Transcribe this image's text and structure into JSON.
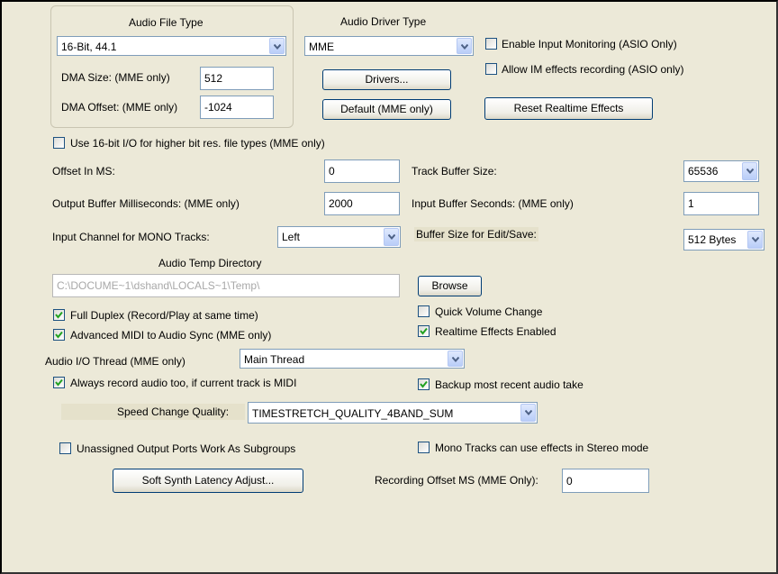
{
  "audio_file_type": {
    "title": "Audio File Type",
    "value": "16-Bit, 44.1"
  },
  "dma_size": {
    "label": "DMA Size: (MME only)",
    "value": "512"
  },
  "dma_offset": {
    "label": "DMA Offset: (MME only)",
    "value": "-1024"
  },
  "audio_driver_type": {
    "title": "Audio Driver Type",
    "value": "MME"
  },
  "enable_input_monitoring": {
    "label": "Enable Input Monitoring (ASIO Only)",
    "checked": false
  },
  "allow_im_effects": {
    "label": "Allow IM effects recording (ASIO only)",
    "checked": false
  },
  "buttons": {
    "drivers": "Drivers...",
    "default_mme": "Default (MME only)",
    "reset_realtime": "Reset Realtime Effects",
    "browse": "Browse",
    "soft_synth": "Soft Synth Latency Adjust..."
  },
  "use_16bit": {
    "label": "Use 16-bit I/O for higher bit res. file types (MME only)",
    "checked": false
  },
  "offset_ms": {
    "label": "Offset In MS:",
    "value": "0"
  },
  "track_buffer": {
    "label": "Track Buffer Size:",
    "value": "65536"
  },
  "output_buffer": {
    "label": "Output Buffer Milliseconds: (MME only)",
    "value": "2000"
  },
  "input_buffer": {
    "label": "Input Buffer Seconds: (MME only)",
    "value": "1"
  },
  "mono_channel": {
    "label": "Input Channel for MONO Tracks:",
    "value": "Left"
  },
  "buffer_edit": {
    "label": "Buffer Size for Edit/Save:",
    "value": "512 Bytes"
  },
  "temp_dir": {
    "label": "Audio Temp Directory",
    "value": "C:\\DOCUME~1\\dshand\\LOCALS~1\\Temp\\"
  },
  "full_duplex": {
    "label": "Full Duplex (Record/Play at same time)",
    "checked": true
  },
  "quick_volume": {
    "label": "Quick Volume Change",
    "checked": false
  },
  "advanced_midi": {
    "label": "Advanced MIDI to Audio Sync (MME only)",
    "checked": true
  },
  "realtime_effects": {
    "label": "Realtime Effects Enabled",
    "checked": true
  },
  "io_thread": {
    "label": "Audio I/O Thread (MME only)",
    "value": "Main Thread"
  },
  "always_record": {
    "label": "Always record audio too, if current track is MIDI",
    "checked": true
  },
  "backup_take": {
    "label": "Backup most recent audio take",
    "checked": true
  },
  "speed_quality": {
    "label": "Speed Change Quality:",
    "value": "TIMESTRETCH_QUALITY_4BAND_SUM"
  },
  "unassigned_ports": {
    "label": "Unassigned Output Ports Work As Subgroups",
    "checked": false
  },
  "mono_stereo": {
    "label": "Mono Tracks can use effects in Stereo mode",
    "checked": false
  },
  "recording_offset": {
    "label": "Recording Offset MS (MME Only):",
    "value": "0"
  }
}
